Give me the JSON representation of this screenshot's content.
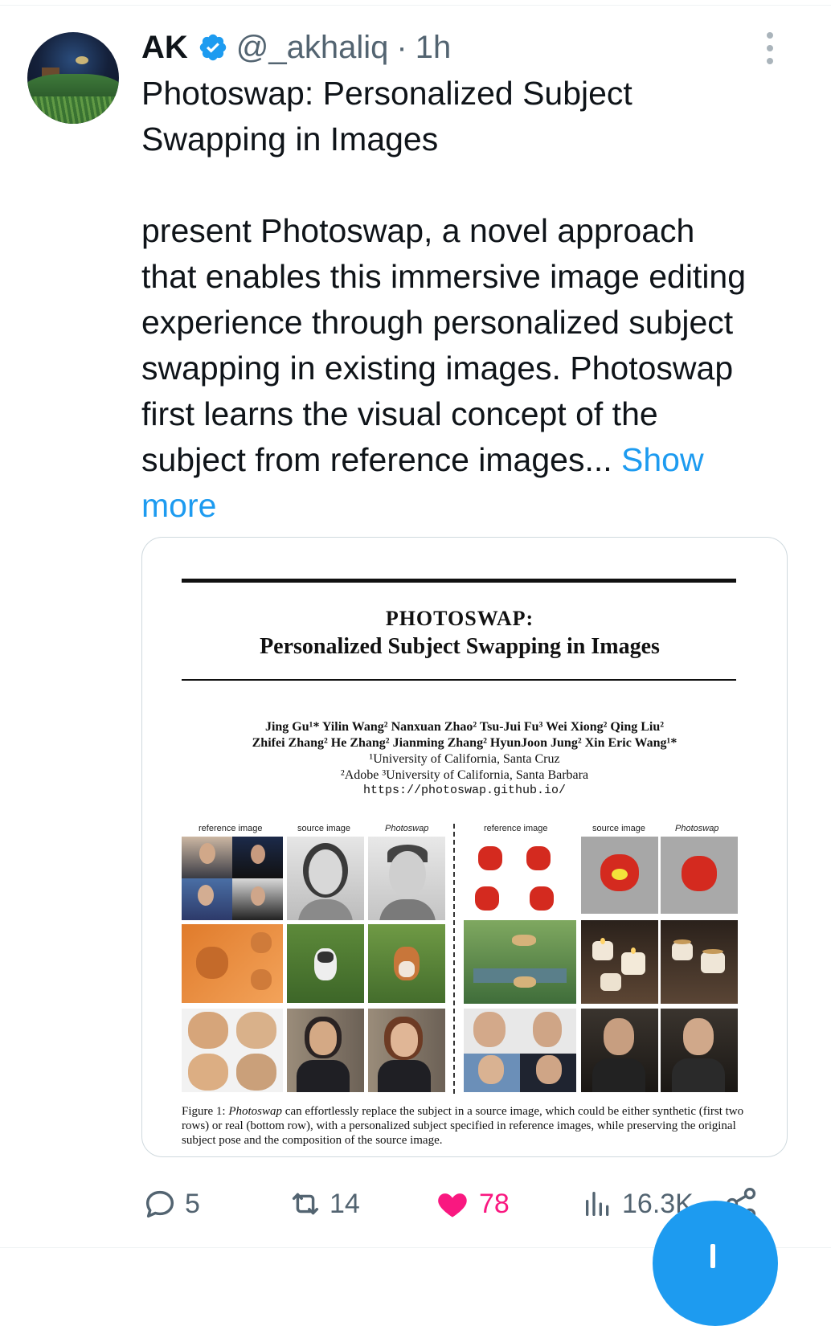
{
  "tweet": {
    "author_name": "AK",
    "verified_icon": "verified-badge-icon",
    "handle": "@_akhaliq",
    "separator": "·",
    "time": "1h",
    "text_line": "Photoswap: Personalized Subject\nSwapping in Images\n\npresent Photoswap, a novel approach\nthat enables this immersive image editing\nexperience through personalized subject\nswapping in existing images. Photoswap\nfirst learns the visual concept of the\nsubject from reference images... ",
    "show_more": "Show\nmore"
  },
  "paper": {
    "title_line1": "PHOTOSWAP:",
    "title_line2": "Personalized Subject Swapping in Images",
    "authors_line1": "Jing Gu¹*   Yilin Wang²   Nanxuan Zhao²   Tsu-Jui Fu³   Wei Xiong²   Qing Liu²",
    "authors_line2": "Zhifei Zhang²   He Zhang²   Jianming Zhang²   HyunJoon Jung²   Xin Eric Wang¹*",
    "affil_line1": "¹University of California, Santa Cruz",
    "affil_line2": "²Adobe  ³University of California, Santa Barbara",
    "url": "https://photoswap.github.io/",
    "col_labels": [
      "reference image",
      "source image",
      "Photoswap",
      "reference image",
      "source image",
      "Photoswap"
    ],
    "caption_prefix": "Figure 1: ",
    "caption_italic": "Photoswap",
    "caption_rest": " can effortlessly replace the subject in a source image, which could be either synthetic (first two rows) or real (bottom row), with a personalized subject specified in reference images, while preserving the original subject pose and the composition of the source image."
  },
  "actions": {
    "replies": "5",
    "retweets": "14",
    "likes": "78",
    "views": "16.3K",
    "icons": [
      "reply-icon",
      "retweet-icon",
      "like-icon",
      "views-icon",
      "share-icon"
    ],
    "like_color": "#f91880",
    "accent_color": "#1d9bf0"
  }
}
